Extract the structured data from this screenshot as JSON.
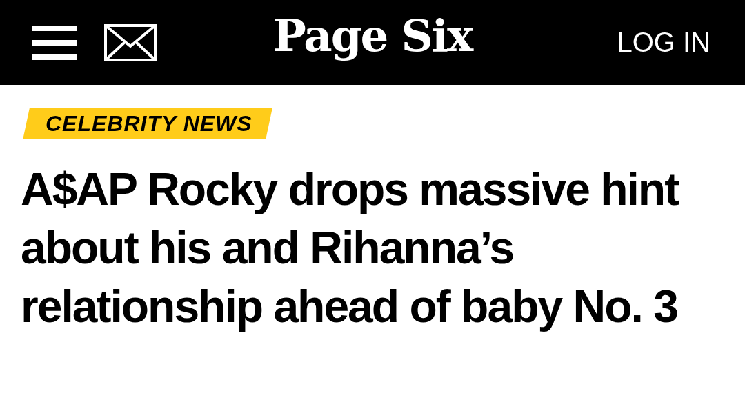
{
  "header": {
    "logo": "Page Six",
    "login": "LOG IN"
  },
  "article": {
    "category": "CELEBRITY NEWS",
    "headline": "A$AP Rocky drops massive hint about his and Rihanna’s relationship ahead of baby No. 3"
  }
}
